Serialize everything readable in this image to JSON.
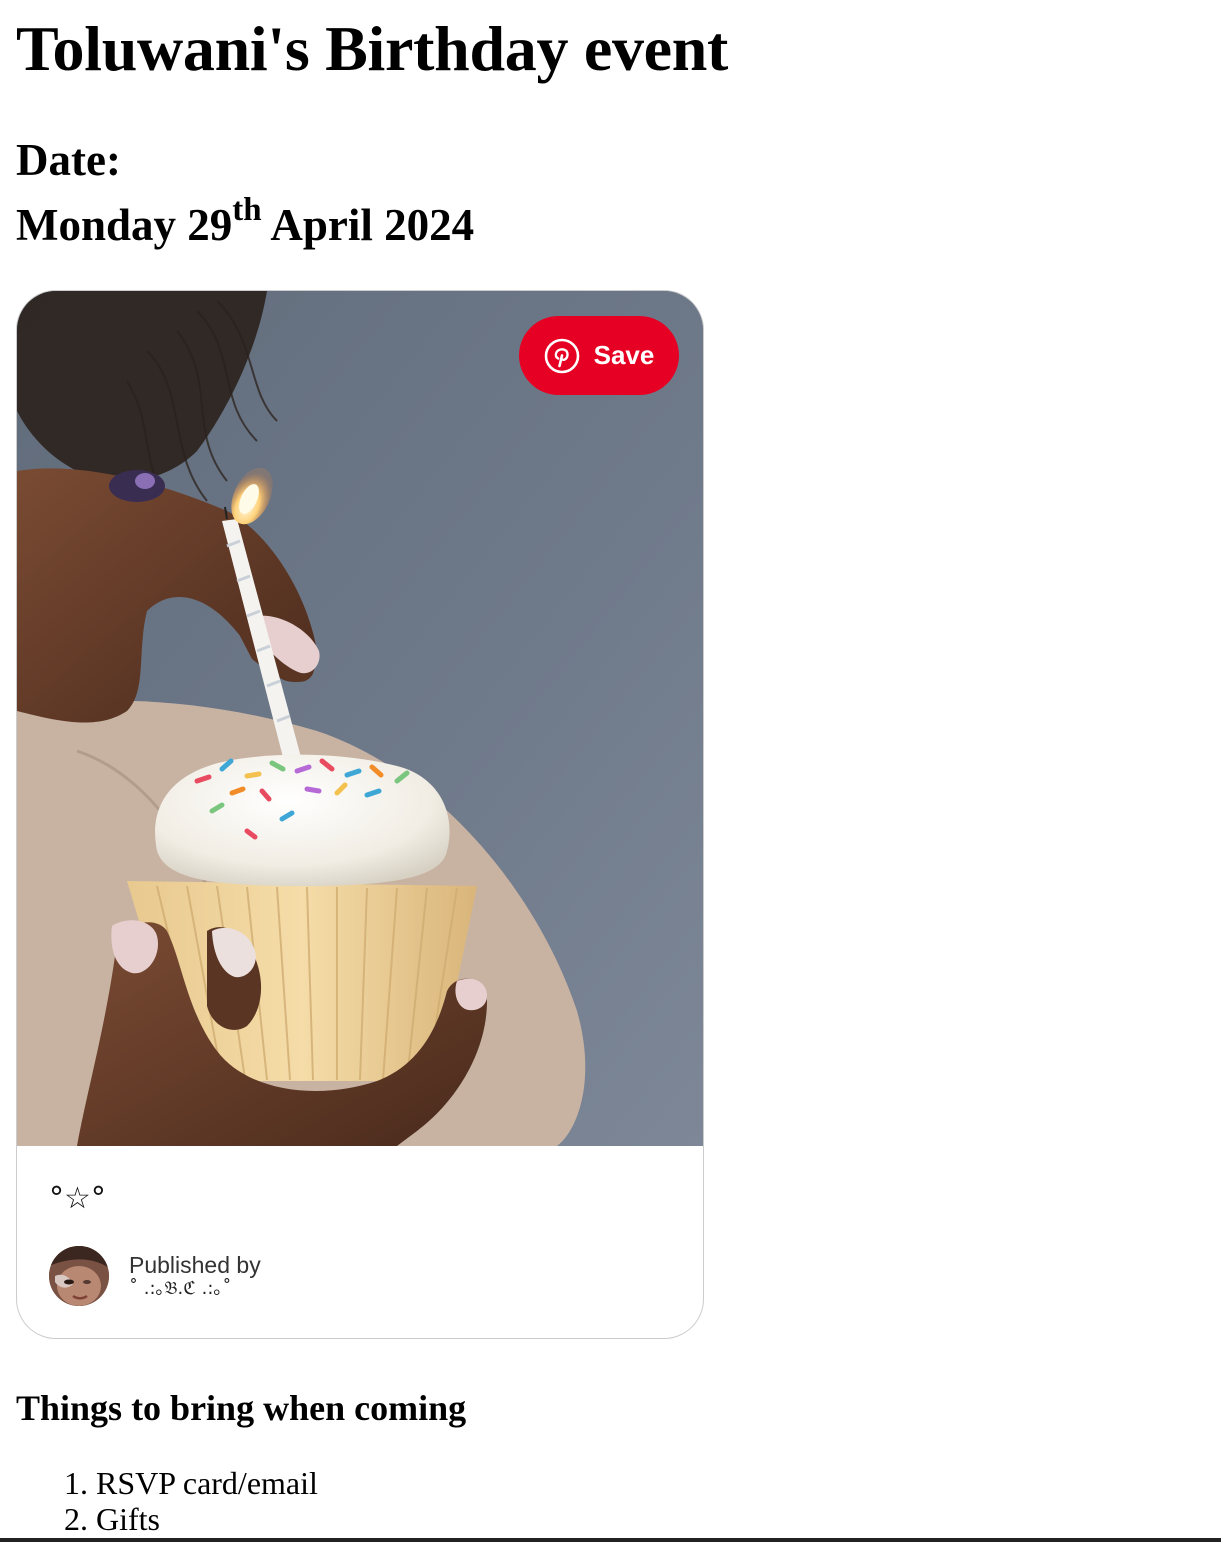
{
  "event": {
    "title": "Toluwani's Birthday event",
    "date_label": "Date:",
    "date_day": "Monday 29",
    "date_suffix": "th",
    "date_rest": " April 2024"
  },
  "pin": {
    "save_label": "Save",
    "save_icon": "pinterest-logo-icon",
    "title": "°☆°",
    "published_by_label": "Published by",
    "publisher_name": "˚ .:｡𝔅.ℭ .:｡˚",
    "image_subject": "hand lighting a candle on a frosted cupcake with sprinkles",
    "colors": {
      "save_bg": "#e60023",
      "backdrop": "#6d7888"
    }
  },
  "bring_list": {
    "heading": "Things to bring when coming",
    "items": [
      "RSVP card/email",
      "Gifts"
    ]
  }
}
